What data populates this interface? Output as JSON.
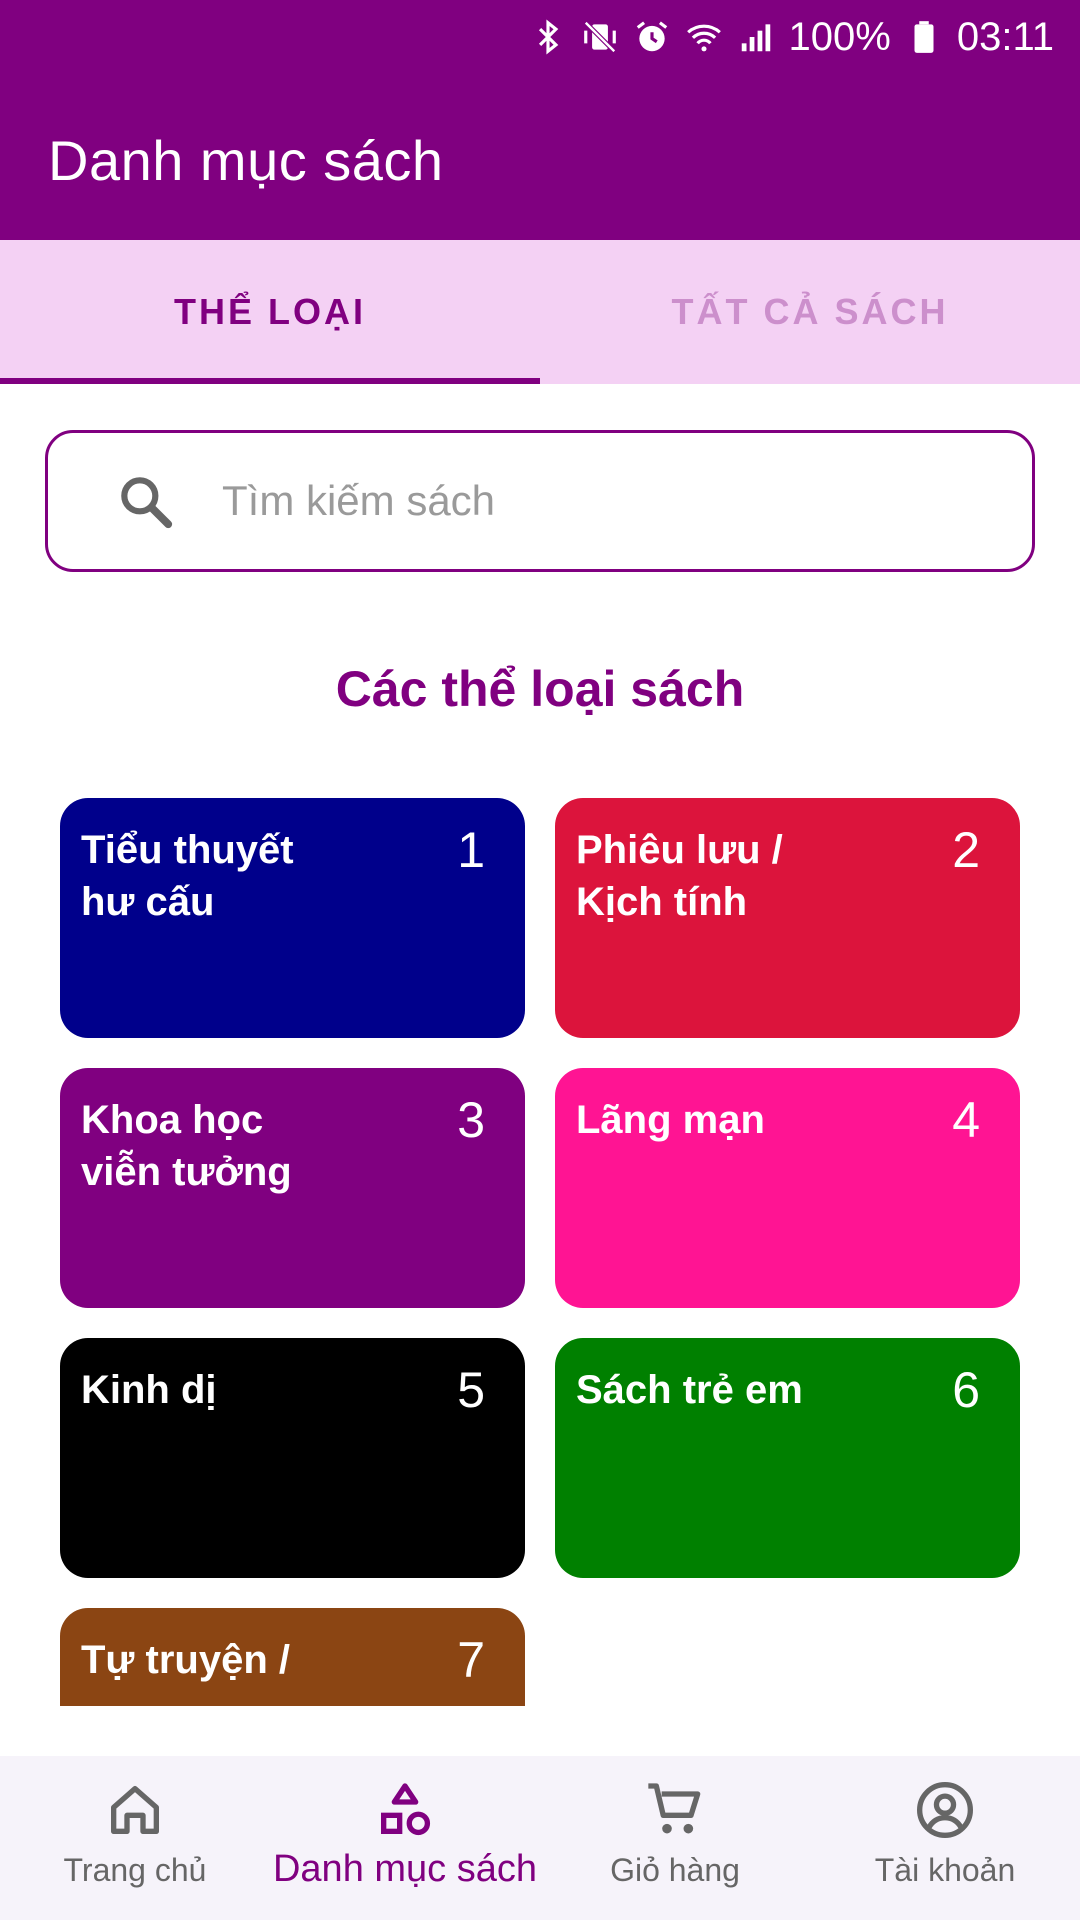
{
  "status_bar": {
    "battery": "100%",
    "time": "03:11",
    "icons": [
      "bluetooth-icon",
      "vibrate-off-icon",
      "alarm-icon",
      "wifi-icon",
      "signal-icon",
      "battery-icon"
    ]
  },
  "app_bar": {
    "title": "Danh mục sách",
    "color": "#800080"
  },
  "tabs": [
    {
      "label": "THỂ LOẠI",
      "active": true
    },
    {
      "label": "TẤT CẢ SÁCH",
      "active": false
    }
  ],
  "search": {
    "placeholder": "Tìm kiếm sách",
    "value": "",
    "icon": "search-icon"
  },
  "section": {
    "title": "Các thể loại sách"
  },
  "categories": [
    {
      "name": "Tiểu thuyết hư cấu",
      "number": "1",
      "color": "#00008B"
    },
    {
      "name": "Phiêu lưu / Kịch tính",
      "number": "2",
      "color": "#DC143C"
    },
    {
      "name": "Khoa học viễn tưởng",
      "number": "3",
      "color": "#800080"
    },
    {
      "name": "Lãng mạn",
      "number": "4",
      "color": "#FF1493"
    },
    {
      "name": "Kinh dị",
      "number": "5",
      "color": "#000000"
    },
    {
      "name": "Sách trẻ em",
      "number": "6",
      "color": "#008000"
    },
    {
      "name": "Tự truyện /",
      "number": "7",
      "color": "#8B4513"
    }
  ],
  "bottom_nav": [
    {
      "label": "Trang chủ",
      "icon": "home-icon",
      "active": false
    },
    {
      "label": "Danh mục sách",
      "icon": "category-icon",
      "active": true
    },
    {
      "label": "Giỏ hàng",
      "icon": "cart-icon",
      "active": false
    },
    {
      "label": "Tài khoản",
      "icon": "account-icon",
      "active": false
    }
  ]
}
